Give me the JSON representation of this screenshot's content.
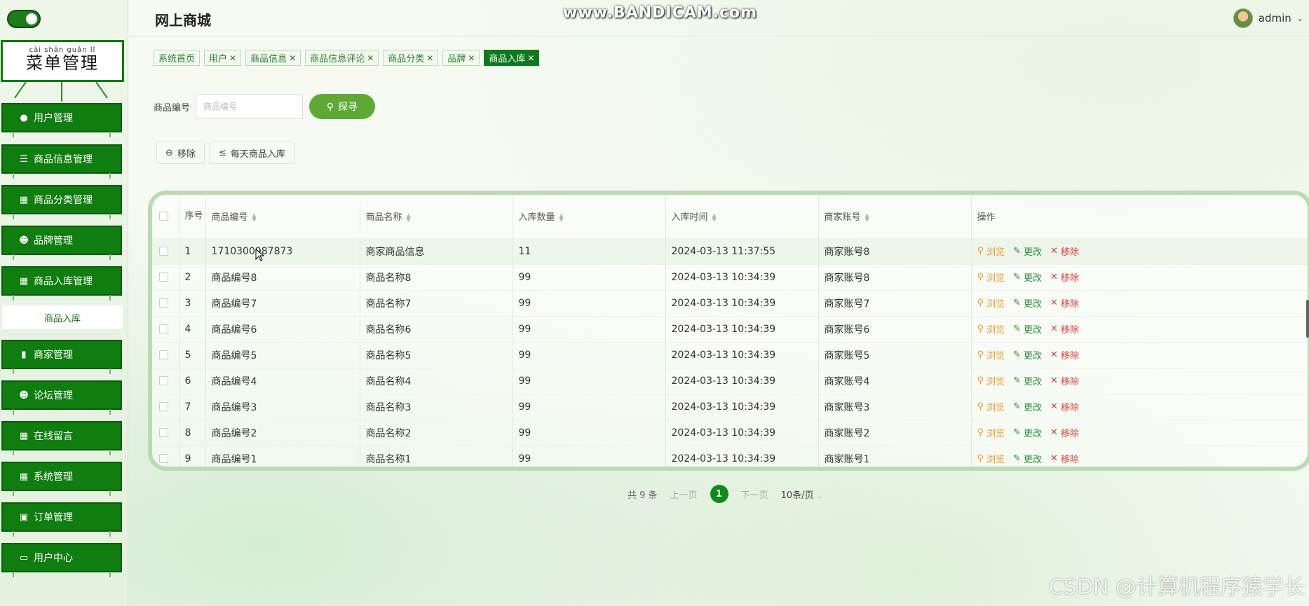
{
  "sidebar": {
    "menu_title": "菜单管理",
    "menu_title_pinyin": "cài shān guǎn lǐ",
    "items": [
      {
        "label": "用户管理",
        "icon": "bulb-icon"
      },
      {
        "label": "商品信息管理",
        "icon": "list-icon"
      },
      {
        "label": "商品分类管理",
        "icon": "grid-icon"
      },
      {
        "label": "品牌管理",
        "icon": "person-icon"
      },
      {
        "label": "商品入库管理",
        "icon": "grid-icon"
      },
      {
        "label": "商家管理",
        "icon": "bar-chart-icon"
      },
      {
        "label": "论坛管理",
        "icon": "person-icon"
      },
      {
        "label": "在线留言",
        "icon": "grid-icon"
      },
      {
        "label": "系统管理",
        "icon": "grid-icon"
      },
      {
        "label": "订单管理",
        "icon": "monitor-icon"
      },
      {
        "label": "用户中心",
        "icon": "card-icon"
      }
    ],
    "submenu_active": "商品入库"
  },
  "header": {
    "brand": "网上商城",
    "watermark": "www.BANDICAM.com",
    "user": "admin"
  },
  "tabs": [
    {
      "label": "系统首页",
      "closable": false,
      "active": false
    },
    {
      "label": "用户",
      "closable": true,
      "active": false
    },
    {
      "label": "商品信息",
      "closable": true,
      "active": false
    },
    {
      "label": "商品信息评论",
      "closable": true,
      "active": false
    },
    {
      "label": "商品分类",
      "closable": true,
      "active": false
    },
    {
      "label": "品牌",
      "closable": true,
      "active": false
    },
    {
      "label": "商品入库",
      "closable": true,
      "active": true
    }
  ],
  "search": {
    "label": "商品编号",
    "placeholder": "商品编号",
    "button": "探寻"
  },
  "actions": {
    "remove": "移除",
    "daily": "每天商品入库"
  },
  "table": {
    "columns": [
      "序号",
      "商品编号",
      "商品名称",
      "入库数量",
      "入库时间",
      "商家账号",
      "操作"
    ],
    "ops": {
      "view": "浏览",
      "edit": "更改",
      "del": "移除"
    },
    "rows": [
      [
        "1",
        "1710300987873",
        "商家商品信息",
        "11",
        "2024-03-13 11:37:55",
        "商家账号8"
      ],
      [
        "2",
        "商品编号8",
        "商品名称8",
        "99",
        "2024-03-13 10:34:39",
        "商家账号8"
      ],
      [
        "3",
        "商品编号7",
        "商品名称7",
        "99",
        "2024-03-13 10:34:39",
        "商家账号7"
      ],
      [
        "4",
        "商品编号6",
        "商品名称6",
        "99",
        "2024-03-13 10:34:39",
        "商家账号6"
      ],
      [
        "5",
        "商品编号5",
        "商品名称5",
        "99",
        "2024-03-13 10:34:39",
        "商家账号5"
      ],
      [
        "6",
        "商品编号4",
        "商品名称4",
        "99",
        "2024-03-13 10:34:39",
        "商家账号4"
      ],
      [
        "7",
        "商品编号3",
        "商品名称3",
        "99",
        "2024-03-13 10:34:39",
        "商家账号3"
      ],
      [
        "8",
        "商品编号2",
        "商品名称2",
        "99",
        "2024-03-13 10:34:39",
        "商家账号2"
      ],
      [
        "9",
        "商品编号1",
        "商品名称1",
        "99",
        "2024-03-13 10:34:39",
        "商家账号1"
      ]
    ]
  },
  "pager": {
    "total": "共 9 条",
    "prev": "上一页",
    "current": "1",
    "next": "下一页",
    "size": "10条/页"
  },
  "footer_watermark": "CSDN @计算机程序猿学长",
  "colors": {
    "primary": "#0f7d0f",
    "accent": "#5ea936",
    "view": "#f09a2e",
    "edit": "#2d8d3d",
    "delete": "#d9433a"
  }
}
